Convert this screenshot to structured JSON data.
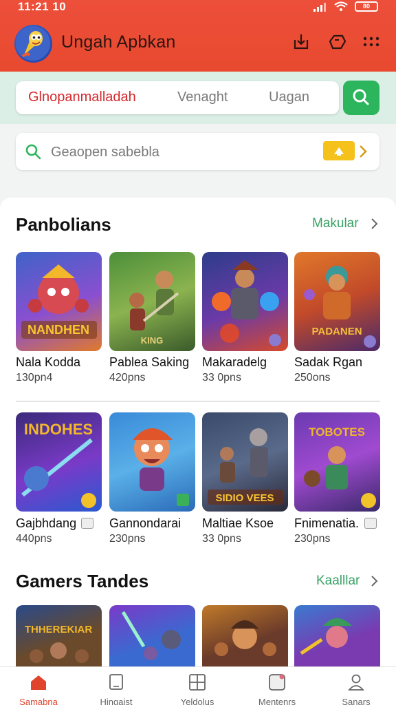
{
  "status": {
    "time": "11:21 10",
    "battery": "80"
  },
  "header": {
    "app_title": "Ungah Apbkan"
  },
  "tabs": [
    {
      "label": "Glnopanmalladah"
    },
    {
      "label": "Venaght"
    },
    {
      "label": "Uagan"
    }
  ],
  "search": {
    "placeholder": "Geaopen sabebla"
  },
  "sections": [
    {
      "title": "Panbolians",
      "more": "Makular",
      "rows": [
        [
          {
            "name": "Nala Kodda",
            "plays": "130pn4",
            "art": "NANDHEN"
          },
          {
            "name": "Pablea Saking",
            "plays": "420pns",
            "art": "KING"
          },
          {
            "name": "Makaradelg",
            "plays": "33 0pns",
            "art": ""
          },
          {
            "name": "Sadak Rgan",
            "plays": "250ons",
            "art": "PADANEN"
          }
        ],
        [
          {
            "name": "Gajbhdang",
            "plays": "440pns",
            "art": "INDOHES"
          },
          {
            "name": "Gannondarai",
            "plays": "230pns",
            "art": ""
          },
          {
            "name": "Maltiae Ksoe",
            "plays": "33 0pns",
            "art": "SIDIO VEES"
          },
          {
            "name": "Fnimenatia.",
            "plays": "230pns",
            "art": "TOBOTES"
          }
        ]
      ]
    },
    {
      "title": "Gamers Tandes",
      "more": "Kaalllar",
      "rows": [
        [
          {
            "art": "THHEREKIAR"
          },
          {
            "art": ""
          },
          {
            "art": ""
          },
          {
            "art": ""
          }
        ]
      ]
    }
  ],
  "bottom_nav": [
    {
      "label": "Samabna",
      "icon": "home-icon"
    },
    {
      "label": "Hingaist",
      "icon": "tablet-icon"
    },
    {
      "label": "Yeldolus",
      "icon": "grid-icon"
    },
    {
      "label": "Mentenrs",
      "icon": "notification-icon"
    },
    {
      "label": "Sanars",
      "icon": "profile-icon"
    }
  ],
  "colors": {
    "header": "#e8492f",
    "accent_green": "#2db55d",
    "active_tab": "#d4282e",
    "more_link": "#3aa266",
    "tab_band": "#dcefe6"
  }
}
